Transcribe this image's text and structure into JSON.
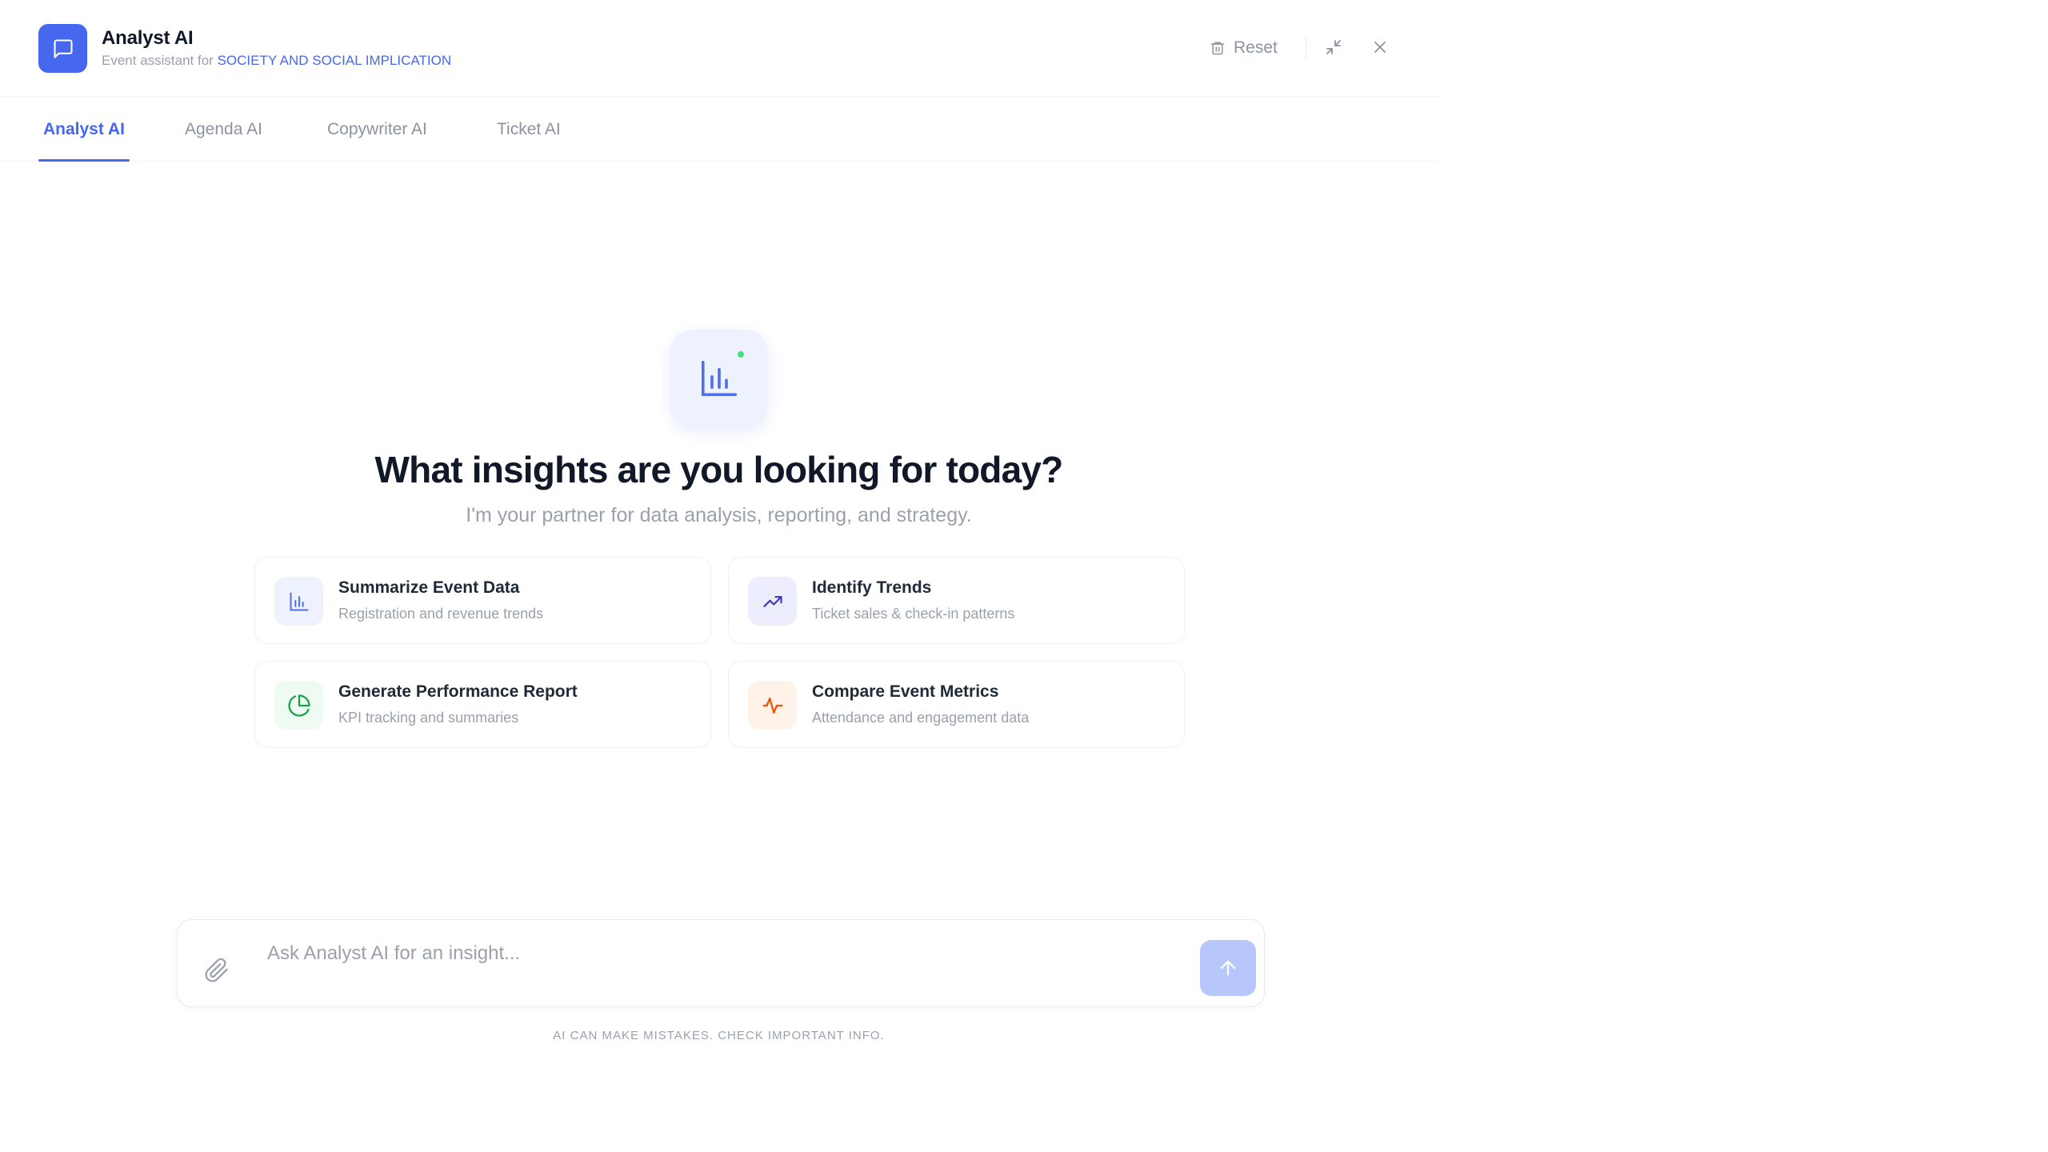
{
  "header": {
    "title": "Analyst AI",
    "subtitle_prefix": "Event assistant for",
    "event_name": "SOCIETY AND SOCIAL IMPLICATION",
    "reset_label": "Reset",
    "logo_icon": "chat-bubble-icon"
  },
  "tabs": [
    {
      "label": "Analyst AI",
      "active": true
    },
    {
      "label": "Agenda AI",
      "active": false
    },
    {
      "label": "Copywriter AI",
      "active": false
    },
    {
      "label": "Ticket AI",
      "active": false
    }
  ],
  "hero": {
    "icon": "bar-chart-icon",
    "title": "What insights are you looking for today?",
    "subtitle": "I'm your partner for data analysis, reporting, and strategy."
  },
  "suggestions": [
    {
      "title": "Summarize Event Data",
      "desc": "Registration and revenue trends",
      "icon": "bar-chart-icon"
    },
    {
      "title": "Identify Trends",
      "desc": "Ticket sales & check-in patterns",
      "icon": "trending-up-icon"
    },
    {
      "title": "Generate Performance Report",
      "desc": "KPI tracking and summaries",
      "icon": "pie-chart-icon"
    },
    {
      "title": "Compare Event Metrics",
      "desc": "Attendance and engagement data",
      "icon": "activity-icon"
    }
  ],
  "composer": {
    "placeholder": "Ask Analyst AI for an insight...",
    "value": ""
  },
  "disclaimer": "AI CAN MAKE MISTAKES. CHECK IMPORTANT INFO.",
  "colors": {
    "accent": "#4668ee",
    "send_disabled": "#b7c6fb",
    "status_online": "#4ade80"
  }
}
